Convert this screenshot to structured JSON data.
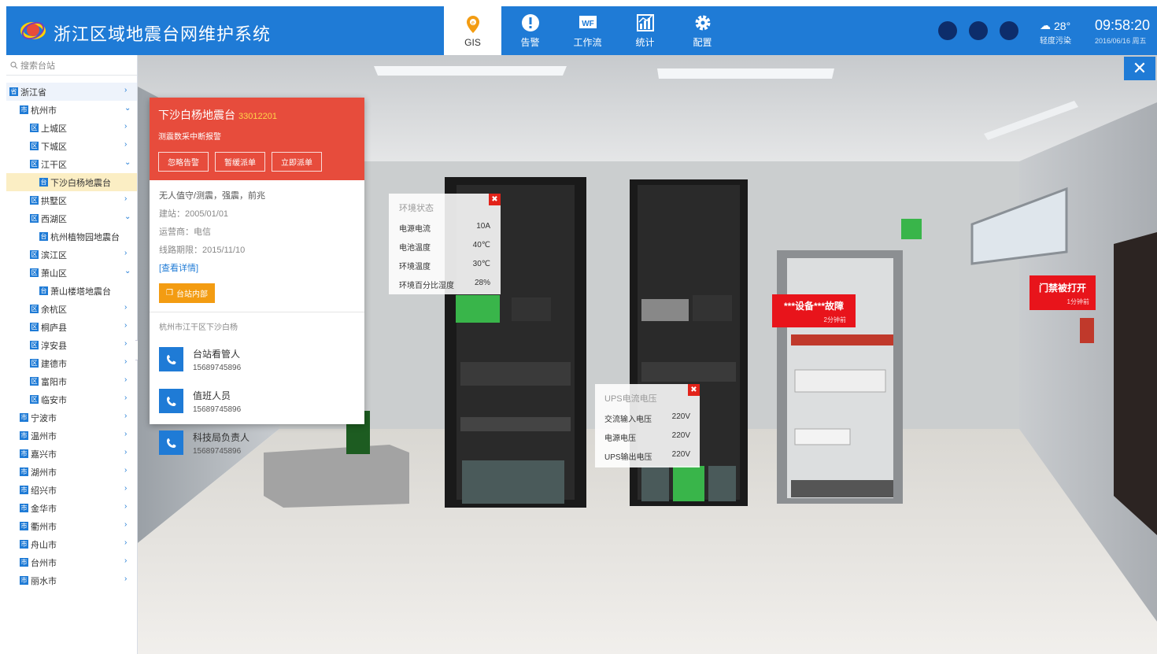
{
  "header": {
    "title": "浙江区域地震台网维护系统",
    "nav": [
      {
        "label": "GIS",
        "icon": "map-pin-icon",
        "active": true
      },
      {
        "label": "告警",
        "icon": "alert-icon",
        "active": false
      },
      {
        "label": "工作流",
        "icon": "workflow-icon",
        "active": false
      },
      {
        "label": "统计",
        "icon": "chart-icon",
        "active": false
      },
      {
        "label": "配置",
        "icon": "gear-icon",
        "active": false
      }
    ],
    "weather": {
      "temp": "28°",
      "air": "轻度污染"
    },
    "time": "09:58:20",
    "date": "2016/06/16 周五",
    "accent": "#1f7bd6"
  },
  "sidebar": {
    "search_placeholder": "搜索台站",
    "tree": [
      {
        "label": "浙江省",
        "badge": "省",
        "level": 0,
        "chev": "›"
      },
      {
        "label": "杭州市",
        "badge": "市",
        "level": 1,
        "chev": "⌄"
      },
      {
        "label": "上城区",
        "badge": "区",
        "level": 2,
        "chev": "›"
      },
      {
        "label": "下城区",
        "badge": "区",
        "level": 2,
        "chev": "›"
      },
      {
        "label": "江干区",
        "badge": "区",
        "level": 2,
        "chev": "⌄"
      },
      {
        "label": "下沙白杨地震台",
        "badge": "台",
        "level": 3,
        "chev": ""
      },
      {
        "label": "拱墅区",
        "badge": "区",
        "level": 2,
        "chev": "›"
      },
      {
        "label": "西湖区",
        "badge": "区",
        "level": 2,
        "chev": "⌄"
      },
      {
        "label": "杭州植物园地震台",
        "badge": "台",
        "level": 3,
        "chev": ""
      },
      {
        "label": "滨江区",
        "badge": "区",
        "level": 2,
        "chev": "›"
      },
      {
        "label": "萧山区",
        "badge": "区",
        "level": 2,
        "chev": "⌄"
      },
      {
        "label": "萧山楼塔地震台",
        "badge": "台",
        "level": 3,
        "chev": ""
      },
      {
        "label": "余杭区",
        "badge": "区",
        "level": 2,
        "chev": "›"
      },
      {
        "label": "桐庐县",
        "badge": "区",
        "level": 2,
        "chev": "›"
      },
      {
        "label": "淳安县",
        "badge": "区",
        "level": 2,
        "chev": "›"
      },
      {
        "label": "建德市",
        "badge": "区",
        "level": 2,
        "chev": "›"
      },
      {
        "label": "富阳市",
        "badge": "区",
        "level": 2,
        "chev": "›"
      },
      {
        "label": "临安市",
        "badge": "区",
        "level": 2,
        "chev": "›"
      },
      {
        "label": "宁波市",
        "badge": "市",
        "level": 1,
        "chev": "›"
      },
      {
        "label": "温州市",
        "badge": "市",
        "level": 1,
        "chev": "›"
      },
      {
        "label": "嘉兴市",
        "badge": "市",
        "level": 1,
        "chev": "›"
      },
      {
        "label": "湖州市",
        "badge": "市",
        "level": 1,
        "chev": "›"
      },
      {
        "label": "绍兴市",
        "badge": "市",
        "level": 1,
        "chev": "›"
      },
      {
        "label": "金华市",
        "badge": "市",
        "level": 1,
        "chev": "›"
      },
      {
        "label": "衢州市",
        "badge": "市",
        "level": 1,
        "chev": "›"
      },
      {
        "label": "舟山市",
        "badge": "市",
        "level": 1,
        "chev": "›"
      },
      {
        "label": "台州市",
        "badge": "市",
        "level": 1,
        "chev": "›"
      },
      {
        "label": "丽水市",
        "badge": "市",
        "level": 1,
        "chev": "›"
      }
    ]
  },
  "station": {
    "name": "下沙白杨地震台",
    "code": "33012201",
    "alarm": "测震数采中断报警",
    "buttons": [
      "忽略告警",
      "暂缓派单",
      "立即派单"
    ],
    "desc": "无人值守/测震，强震，前兆",
    "built": "建站：2005/01/01",
    "operator": "运营商：电信",
    "line_term": "线路期限：2015/11/10",
    "detail_link": "[查看详情]",
    "inside_button": "台站内部",
    "address": "杭州市江干区下沙白杨",
    "contacts": [
      {
        "role": "台站看管人",
        "phone": "15689745896"
      },
      {
        "role": "值班人员",
        "phone": "15689745896"
      },
      {
        "role": "科技局负责人",
        "phone": "15689745896"
      }
    ],
    "alert_color": "#e74c3c"
  },
  "env_popup": {
    "title": "环境状态",
    "rows": [
      {
        "k": "电源电流",
        "v": "10A"
      },
      {
        "k": "电池温度",
        "v": "40℃"
      },
      {
        "k": "环境温度",
        "v": "30℃"
      },
      {
        "k": "环境百分比湿度",
        "v": "28%"
      }
    ]
  },
  "ups_popup": {
    "title": "UPS电流电压",
    "rows": [
      {
        "k": "交流输入电压",
        "v": "220V"
      },
      {
        "k": "电源电压",
        "v": "220V"
      },
      {
        "k": "UPS输出电压",
        "v": "220V"
      }
    ]
  },
  "faults": [
    {
      "text": "***设备***故障",
      "time": "2分钟前"
    },
    {
      "text": "门禁被打开",
      "time": "1分钟前"
    }
  ],
  "close_glyph": "✕",
  "popup_close_glyph": "✖"
}
